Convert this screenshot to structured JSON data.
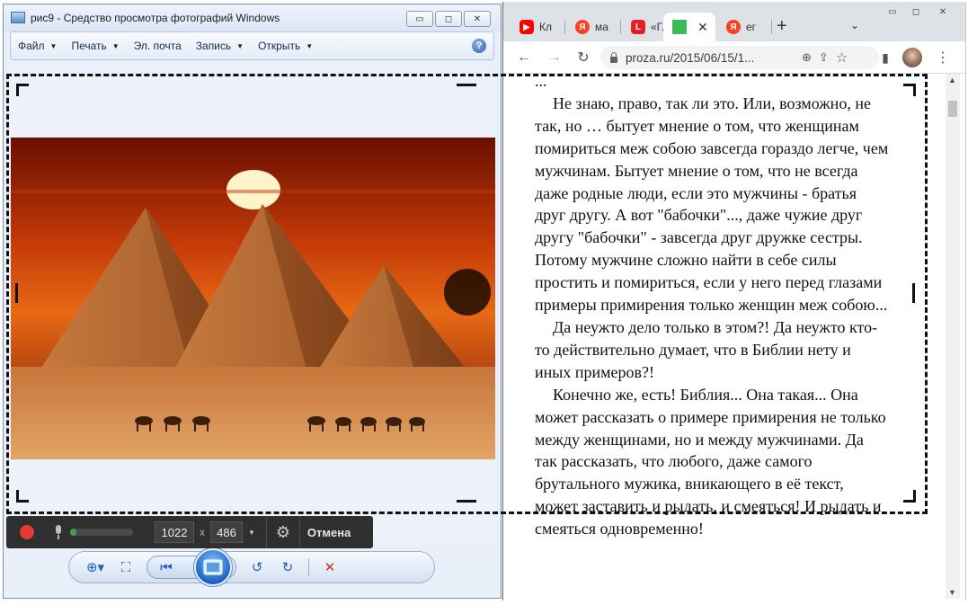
{
  "photo_viewer": {
    "title": "рис9 - Средство просмотра фотографий Windows",
    "caption_buttons": {
      "minimize": "▭",
      "maximize": "◻",
      "close": "✕"
    },
    "menu": [
      {
        "label": "Файл",
        "has_dropdown": true
      },
      {
        "label": "Печать",
        "has_dropdown": true
      },
      {
        "label": "Эл. почта",
        "has_dropdown": false
      },
      {
        "label": "Запись",
        "has_dropdown": true
      },
      {
        "label": "Открыть",
        "has_dropdown": true
      }
    ],
    "help_glyph": "?",
    "image": "pyramids-with-camels-at-sunset",
    "bottom_icons": [
      "zoom-icon",
      "fit-window-icon",
      "previous-icon",
      "slideshow-icon",
      "next-icon",
      "rotate-left-icon",
      "rotate-right-icon",
      "delete-icon"
    ]
  },
  "browser": {
    "tabs": [
      {
        "label": "Кл",
        "favicon": "youtube-icon",
        "favicon_color": "#ff0000"
      },
      {
        "label": "ма",
        "favicon": "yandex-icon",
        "favicon_color": "#fc3f1d"
      },
      {
        "label": "«Гл",
        "favicon": "l-logo-icon",
        "favicon_color": "#e31e24"
      },
      {
        "label": "",
        "favicon": "green-square-icon",
        "favicon_color": "#3cba54",
        "active": true
      },
      {
        "label": "ег",
        "favicon": "yandex-icon",
        "favicon_color": "#fc3f1d"
      }
    ],
    "url": "proza.ru/2015/06/15/1...",
    "article": {
      "top_cut": "...",
      "paragraphs": [
        "Не знаю, право, так ли это. Или, возможно, не так, но … бытует мнение о том, что женщинам помириться меж собою завсегда гораздо легче, чем мужчинам. Бытует мнение о том, что не всегда даже родные люди, если это мужчины - братья друг другу. А  вот \"бабочки\"..., даже чужие  друг другу \"бабочки\" - завсегда  друг дружке сестры. Потому мужчине сложно найти в себе силы простить и помириться, если у него перед глазами примеры примирения только женщин меж собою...",
        "Да неужто дело только в этом?! Да неужто кто-то действительно думает, что в Библии нету и иных примеров?!",
        "Конечно же, есть! Библия... Она такая... Она может рассказать о примере примирения не только между женщинами, но и между мужчинами. Да так рассказать, что любого, даже самого брутального мужика, вникающего в её текст, может заставить и рыдать, и смеяться! И рыдать и смеяться одновременно!"
      ]
    }
  },
  "capture_toolbar": {
    "width_value": "1022",
    "height_value": "486",
    "times": "x",
    "cancel_label": "Отмена",
    "mic_level": 0.1,
    "record_color": "#e53935"
  }
}
